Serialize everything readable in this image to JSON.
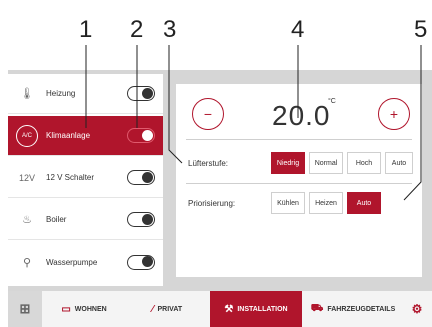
{
  "callouts": [
    "1",
    "2",
    "3",
    "4",
    "5"
  ],
  "left_panel": {
    "items": [
      {
        "icon": "thermometer-icon",
        "glyph": "🌡",
        "label": "Heizung",
        "toggle": "off"
      },
      {
        "icon": "ac-icon",
        "glyph": "A/C",
        "label": "Klimaanlage",
        "toggle": "on"
      },
      {
        "icon": "12v-icon",
        "glyph": "12V",
        "label": "12 V Schalter",
        "toggle": "off"
      },
      {
        "icon": "boiler-icon",
        "glyph": "♨",
        "label": "Boiler",
        "toggle": "off"
      },
      {
        "icon": "water-pump-icon",
        "glyph": "⚲",
        "label": "Wasserpumpe",
        "toggle": "off"
      }
    ]
  },
  "climate": {
    "minus_label": "−",
    "plus_label": "+",
    "temperature": "20.0",
    "unit": "°C",
    "fan_label": "Lüfterstufe:",
    "fan_options": [
      "Niedrig",
      "Normal",
      "Hoch",
      "Auto"
    ],
    "fan_selected": "Niedrig",
    "priority_label": "Priorisierung:",
    "priority_options": [
      "Kühlen",
      "Heizen",
      "Auto"
    ],
    "priority_selected": "Auto"
  },
  "bottom_nav": {
    "home_glyph": "⊞",
    "items": [
      {
        "icon": "living-icon",
        "glyph": "▭",
        "label": "WOHNEN"
      },
      {
        "icon": "private-icon",
        "glyph": "⁄",
        "label": "PRIVAT"
      },
      {
        "icon": "installation-icon",
        "glyph": "⚒",
        "label": "INSTALLATION",
        "active": true
      },
      {
        "icon": "vehicle-icon",
        "glyph": "⛟",
        "label": "FAHRZEUGDETAILS"
      }
    ],
    "settings_glyph": "⚙"
  },
  "colors": {
    "accent": "#b0152c",
    "frame": "#d6d6d6"
  }
}
